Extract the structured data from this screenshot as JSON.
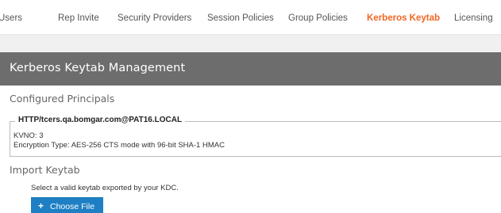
{
  "tabs": [
    {
      "label": "Users"
    },
    {
      "label": "Rep Invite"
    },
    {
      "label": "Security Providers"
    },
    {
      "label": "Session Policies"
    },
    {
      "label": "Group Policies"
    },
    {
      "label": "Kerberos Keytab",
      "active": true
    },
    {
      "label": "Licensing"
    }
  ],
  "colors": {
    "accent": "#f26522",
    "header_bg": "#6d6d6d",
    "button_bg": "#1e7fc4"
  },
  "panel": {
    "title": "Kerberos Keytab Management"
  },
  "configured": {
    "title": "Configured Principals",
    "principal": "HTTP/tcers.qa.bomgar.com@PAT16.LOCAL",
    "kvno": "KVNO: 3",
    "encryption": "Encryption Type: AES-256 CTS mode with 96-bit SHA-1 HMAC"
  },
  "import": {
    "title": "Import Keytab",
    "description": "Select a valid keytab exported by your KDC.",
    "button_label": "Choose File",
    "button_icon": "plus-icon"
  }
}
